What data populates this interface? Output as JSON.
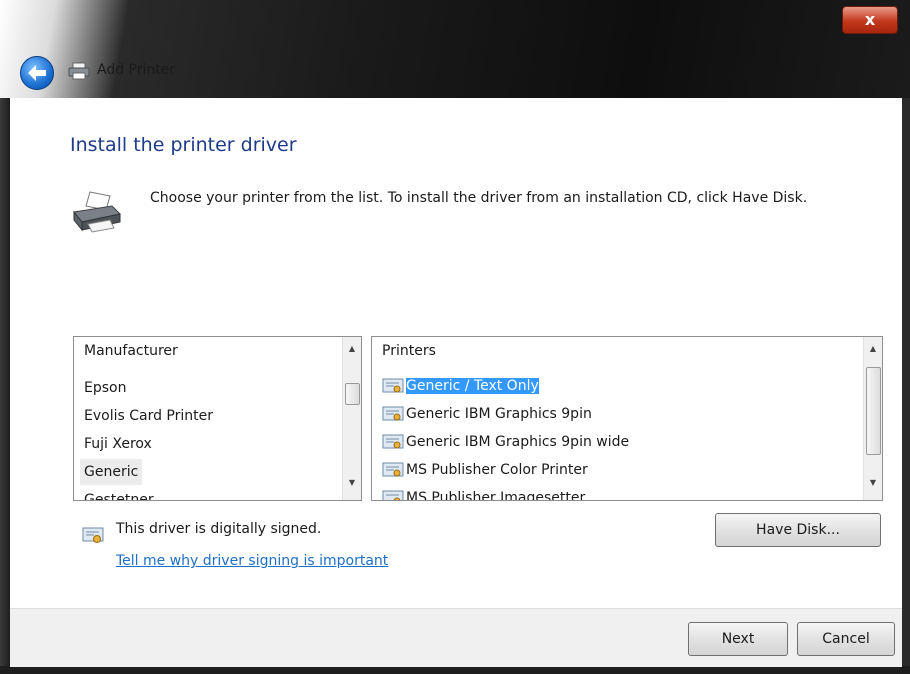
{
  "window": {
    "title": "Add Printer",
    "close_glyph": "x"
  },
  "page": {
    "heading": "Install the printer driver",
    "instruction": "Choose your printer from the list. To install the driver from an installation CD, click Have Disk."
  },
  "manufacturer_list": {
    "header": "Manufacturer",
    "items": [
      "Epson",
      "Evolis Card Printer",
      "Fuji Xerox",
      "Generic",
      "Gestetner"
    ],
    "selected": "Generic"
  },
  "printers_list": {
    "header": "Printers",
    "items": [
      "Generic / Text Only",
      "Generic IBM Graphics 9pin",
      "Generic IBM Graphics 9pin wide",
      "MS Publisher Color Printer",
      "MS Publisher Imagesetter"
    ],
    "selected": "Generic / Text Only"
  },
  "signing": {
    "status": "This driver is digitally signed.",
    "link": "Tell me why driver signing is important"
  },
  "buttons": {
    "have_disk": "Have Disk...",
    "next": "Next",
    "cancel": "Cancel"
  },
  "colors": {
    "heading": "#1e3a8a",
    "link": "#1e6fc7",
    "selection": "#3399ff",
    "close": "#c2381d"
  },
  "icons": [
    "back-arrow-icon",
    "printer-icon",
    "certificate-icon",
    "close-icon"
  ]
}
